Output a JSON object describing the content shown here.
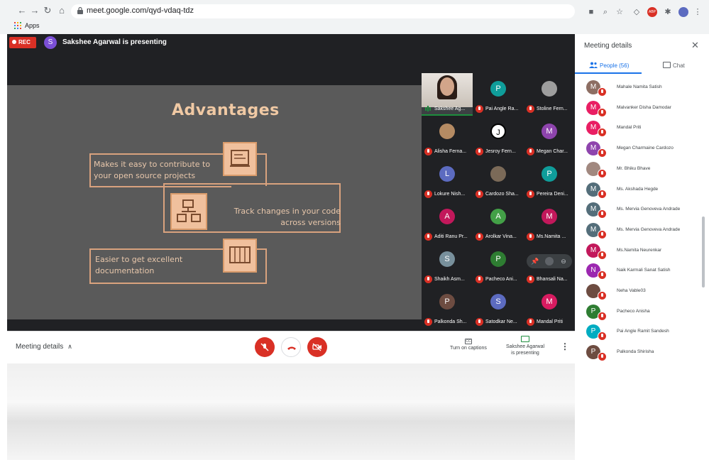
{
  "browser": {
    "url": "meet.google.com/qyd-vdaq-tdz",
    "bookmark_apps": "Apps",
    "ext_badge": "ABP"
  },
  "meet": {
    "rec_label": "REC",
    "presenter_initial": "S",
    "presenting_banner": "Sakshee Agarwal is presenting"
  },
  "slide": {
    "title": "Advantages",
    "point1": "Makes it easy to contribute to your open source projects",
    "point2": "Track changes in your code across versions",
    "point3": "Easier to get excellent documentation"
  },
  "tiles": [
    {
      "name": "Sakshee Ag...",
      "initial": "",
      "color": "#000000",
      "video": true
    },
    {
      "name": "Pai Angle Ra...",
      "initial": "P",
      "color": "#0f9d9a"
    },
    {
      "name": "Stoline Fern...",
      "initial": "",
      "color": "#9e9e9e"
    },
    {
      "name": "Alisha Ferna...",
      "initial": "",
      "color": "#b58b63"
    },
    {
      "name": "Jesroy Fern...",
      "initial": "J",
      "color": "#ffffff"
    },
    {
      "name": "Megan Char...",
      "initial": "M",
      "color": "#8e44ad"
    },
    {
      "name": "Lokure Nish...",
      "initial": "L",
      "color": "#5c6bc0"
    },
    {
      "name": "Cardozo Sha...",
      "initial": "",
      "color": "#7b6a58"
    },
    {
      "name": "Pereira Deni...",
      "initial": "P",
      "color": "#0f9d9a"
    },
    {
      "name": "Aditi Ranu Pr...",
      "initial": "A",
      "color": "#c2185b"
    },
    {
      "name": "Arolkar Vina...",
      "initial": "A",
      "color": "#43a047"
    },
    {
      "name": "Ms.Namita ...",
      "initial": "M",
      "color": "#c2185b"
    },
    {
      "name": "Shaikh Asm...",
      "initial": "S",
      "color": "#78909c"
    },
    {
      "name": "Pacheco Ani...",
      "initial": "P",
      "color": "#2e7d32"
    },
    {
      "name": "Bhansali Na...",
      "initial": "",
      "color": "#3c4043"
    },
    {
      "name": "Palkonda Sh...",
      "initial": "P",
      "color": "#6d4c41"
    },
    {
      "name": "Satodkar Ne...",
      "initial": "S",
      "color": "#5c6bc0"
    },
    {
      "name": "Mandal Priti",
      "initial": "M",
      "color": "#d81b60"
    }
  ],
  "bottom_bar": {
    "meeting_details": "Meeting details",
    "captions": "Turn on captions",
    "presenting_line1": "Sakshee Agarwal",
    "presenting_line2": "is presenting"
  },
  "panel": {
    "title": "Meeting details",
    "tab_people": "People (56)",
    "tab_chat": "Chat",
    "people": [
      {
        "name": "Mahale Namita Satish",
        "initial": "M",
        "color": "#8d6e63"
      },
      {
        "name": "Malvanker Disha Damodar",
        "initial": "M",
        "color": "#e91e63"
      },
      {
        "name": "Mandal Priti",
        "initial": "M",
        "color": "#e91e63"
      },
      {
        "name": "Megan Charmaine Cardozo",
        "initial": "M",
        "color": "#8e44ad"
      },
      {
        "name": "Mr. Bhiku Bhave",
        "initial": "",
        "color": "#a1887f"
      },
      {
        "name": "Ms. Akshada Hegde",
        "initial": "M",
        "color": "#546e7a"
      },
      {
        "name": "Ms. Mervia Genoveva Andrade",
        "initial": "M",
        "color": "#546e7a"
      },
      {
        "name": "Ms. Mervia Genoveva Andrade",
        "initial": "M",
        "color": "#546e7a"
      },
      {
        "name": "Ms.Namita Neurenkar",
        "initial": "M",
        "color": "#c2185b"
      },
      {
        "name": "Naik Karmali Sanat Satish",
        "initial": "N",
        "color": "#9c27b0"
      },
      {
        "name": "Neha Vable03",
        "initial": "",
        "color": "#6d4c41"
      },
      {
        "name": "Pacheco Anisha",
        "initial": "P",
        "color": "#2e7d32"
      },
      {
        "name": "Pai Angle Ramit Sandesh",
        "initial": "P",
        "color": "#00acc1"
      },
      {
        "name": "Palkonda Shirisha",
        "initial": "P",
        "color": "#6d4c41"
      }
    ]
  },
  "colors": {
    "accent": "#1a73e8",
    "danger": "#d93025",
    "stage_bg": "#202124",
    "slide_accent": "#f0c09d"
  }
}
